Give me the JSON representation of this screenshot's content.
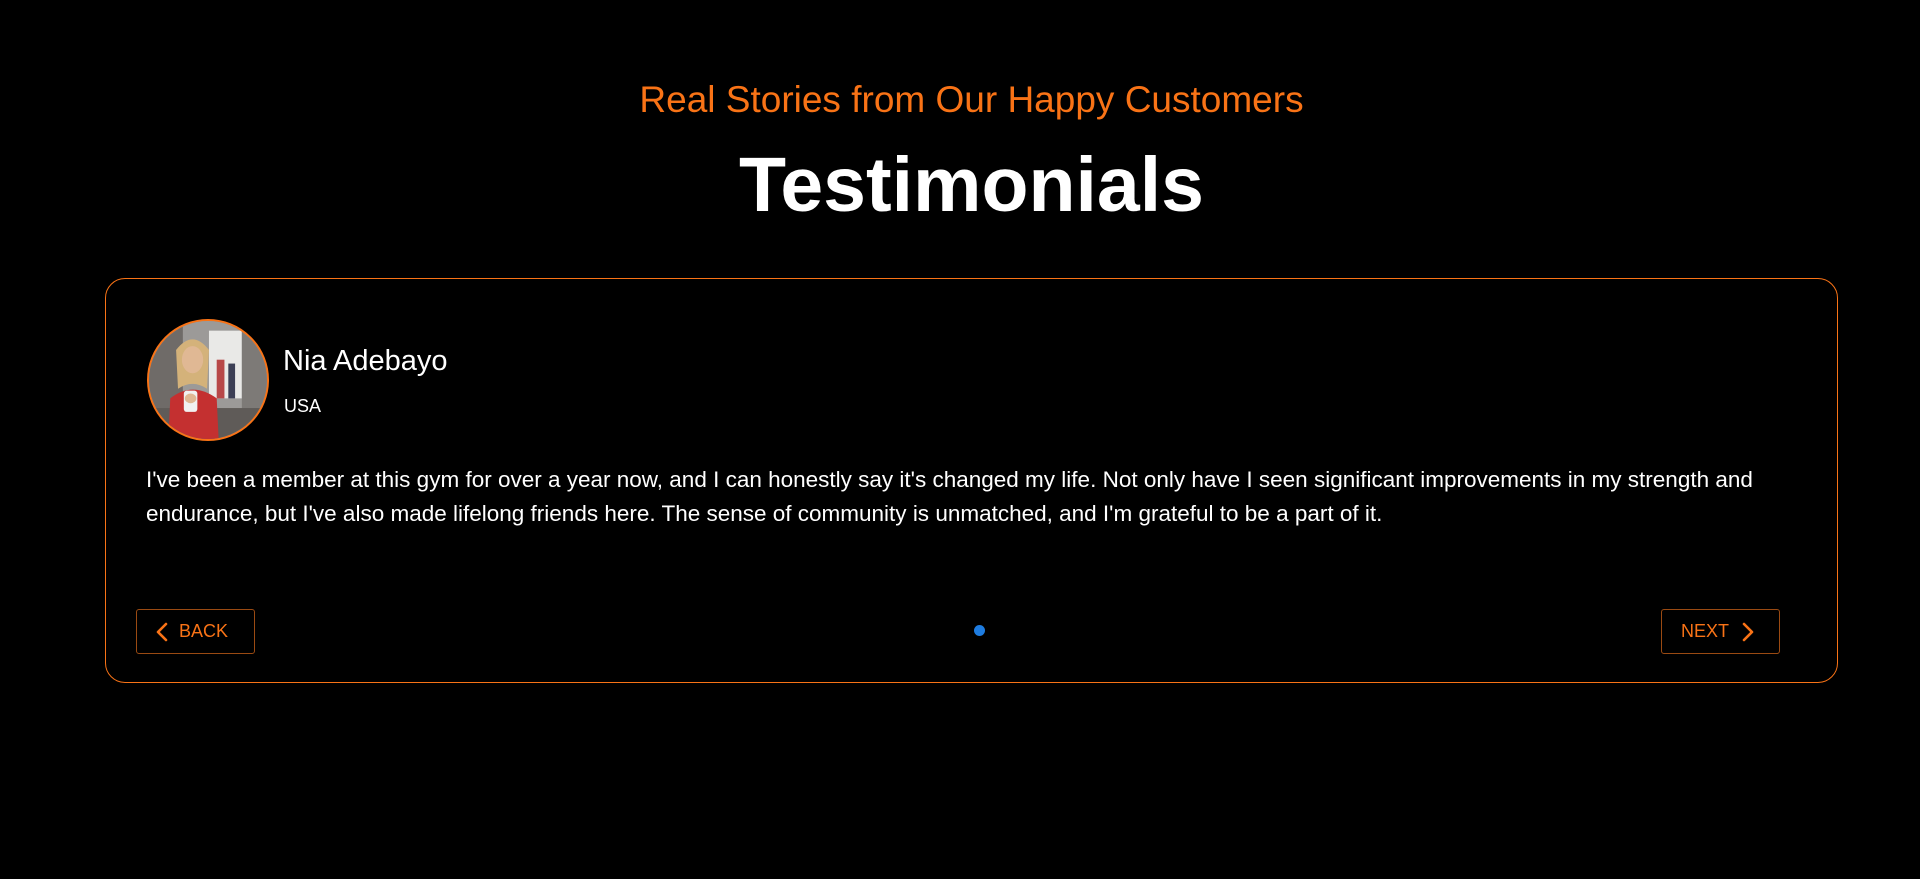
{
  "header": {
    "subtitle": "Real Stories from Our Happy Customers",
    "title": "Testimonials"
  },
  "testimonial": {
    "name": "Nia Adebayo",
    "country": "USA",
    "quote": "I've been a member at this gym for over a year now, and I can honestly say it's changed my life. Not only have I seen significant improvements in my strength and endurance, but I've also made lifelong friends here. The sense of community is unmatched, and I'm grateful to be a part of it."
  },
  "controls": {
    "back_label": "BACK",
    "next_label": "NEXT",
    "back_icon": "chevron-left-icon",
    "next_icon": "chevron-right-icon"
  },
  "pagination": {
    "total": 1,
    "active_index": 0
  },
  "colors": {
    "background": "#000000",
    "accent": "#f97316",
    "text": "#ffffff",
    "active_dot": "#1e7ce0"
  }
}
